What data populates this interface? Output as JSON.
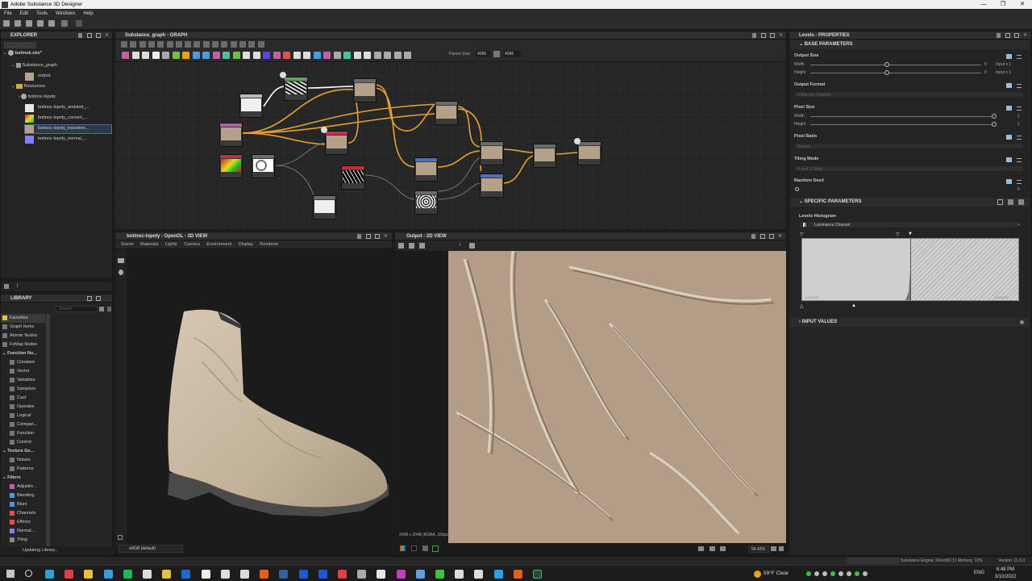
{
  "window": {
    "title": "Adobe Substance 3D Designer",
    "minimize": "—",
    "maximize": "❐",
    "close": "✕"
  },
  "menu": [
    "File",
    "Edit",
    "Tools",
    "Windows",
    "Help"
  ],
  "explorer": {
    "title": "EXPLORER",
    "items": [
      {
        "label": "botinok.sbs*"
      },
      {
        "label": "Substance_graph"
      },
      {
        "label": "output"
      },
      {
        "label": "Resources"
      },
      {
        "label": "botinoc-lopoly"
      },
      {
        "label": "botinoc-lopoly_ambient_..."
      },
      {
        "label": "botinoc-lopoly_convert_..."
      },
      {
        "label": "botinoc-lopoly_transfere..."
      },
      {
        "label": "botinoc-lopoly_normal_..."
      }
    ]
  },
  "graph": {
    "title": "Substance_graph - GRAPH",
    "parent_size_label": "Parent Size:",
    "parent_size": "4096",
    "size2": "4096"
  },
  "view3d": {
    "title": "botinoc-lopoly - OpenGL - 3D VIEW",
    "menu": [
      "Scene",
      "Materials",
      "Lights",
      "Camera",
      "Environment",
      "Display",
      "Renderer"
    ],
    "colorspace": "sRGB (default)"
  },
  "view2d": {
    "title": "Output - 2D VIEW",
    "info": "2048 x 2048 (RGBA, 16bpc)",
    "zoom": "54.42%"
  },
  "library": {
    "title": "LIBRARY",
    "search_placeholder": "Search",
    "categories": [
      "Favorites",
      "Graph Items",
      "Atomic Nodes",
      "FxMap Nodes"
    ],
    "function_header": "Function No...",
    "function_items": [
      "Constant",
      "Vector",
      "Variables",
      "Samplers",
      "Cast",
      "Operator",
      "Logical",
      "Compari...",
      "Function",
      "Control"
    ],
    "texture_header": "Texture Ge...",
    "texture_items": [
      "Noises",
      "Patterns"
    ],
    "filters_header": "Filters",
    "filter_items": [
      "Adjustm...",
      "Blending",
      "Blurs",
      "Channels",
      "Effects",
      "Normal ...",
      "Tiling"
    ],
    "status": "Updating Library..."
  },
  "properties": {
    "title": "Levels - PROPERTIES",
    "base_header": "BASE PARAMETERS",
    "output_size": "Output Size",
    "width": "Width",
    "height": "Height",
    "width_val": "0",
    "height_val": "0",
    "input_x1": "Input x 1",
    "output_format": "Output Format",
    "output_format_val": "8 Bits per Channel",
    "pixel_size": "Pixel Size",
    "px_width_val": "1",
    "px_height_val": "1",
    "pixel_ratio": "Pixel Ratio",
    "pixel_ratio_val": "Square",
    "tiling_mode": "Tiling Mode",
    "tiling_mode_val": "H and V Tiling",
    "random_seed": "Random Seed",
    "random_seed_val": "0",
    "specific_header": "SPECIFIC PARAMETERS",
    "levels_histogram": "Levels Histogram",
    "channel": "Luminance Channel",
    "hist_min": "0.000000",
    "hist_max": "1.000000",
    "input_values": "INPUT VALUES"
  },
  "statusbar": {
    "engine": "Substance Engine: Direct3D 11  Memory: 12%",
    "version": "Version: 11.3.3"
  },
  "taskbar": {
    "weather": "59°F  Clear",
    "lang": "ENG",
    "time": "6:48 PM",
    "date": "3/10/2022"
  }
}
